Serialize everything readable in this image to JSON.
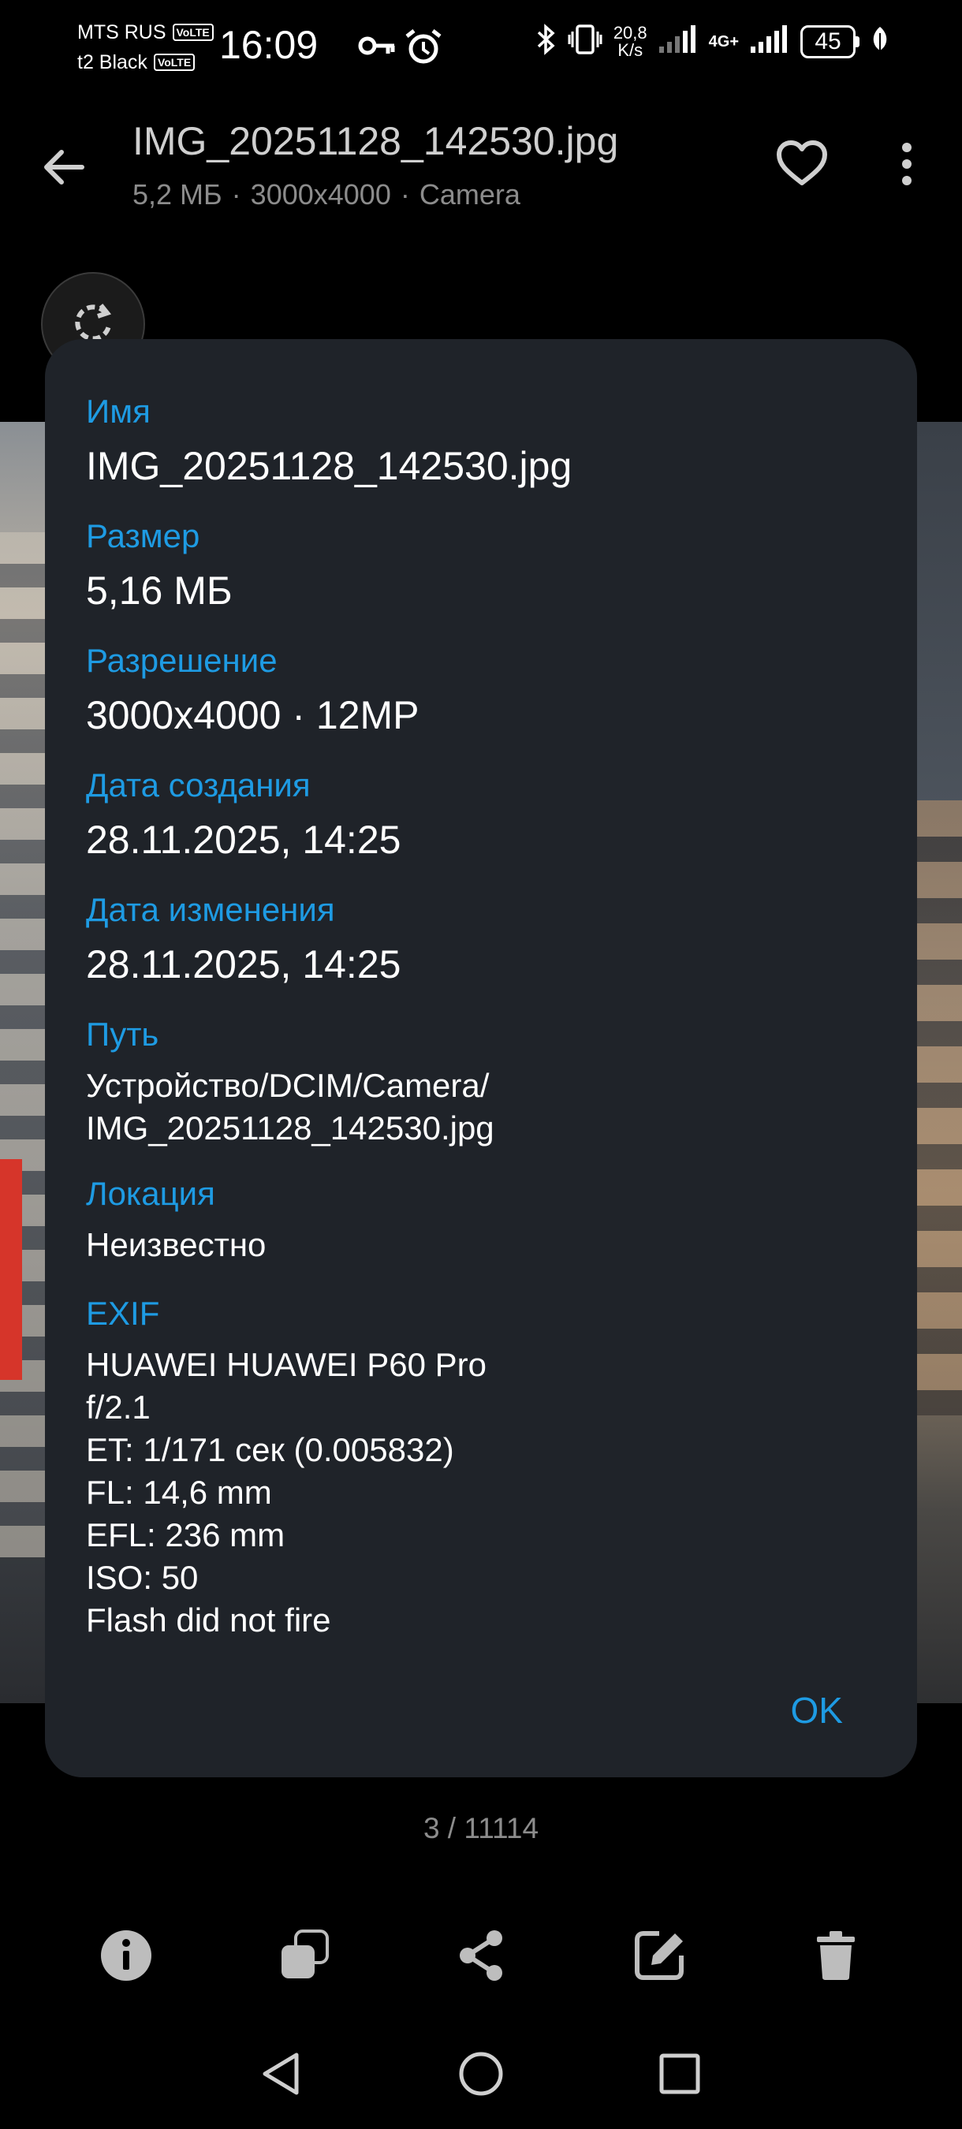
{
  "status_bar": {
    "carrier1": "MTS RUS",
    "carrier2": "t2 Black",
    "volte": "VoLTE",
    "time": "16:09",
    "speed_value": "20,8",
    "speed_unit": "K/s",
    "network": "4G+",
    "battery": "45",
    "icons": [
      "key-icon",
      "alarm-icon",
      "bluetooth-icon",
      "vibrate-icon",
      "signal-icon",
      "signal-icon",
      "battery-icon",
      "leaf-icon"
    ]
  },
  "header": {
    "title": "IMG_20251128_142530.jpg",
    "size": "5,2 МБ",
    "resolution": "3000x4000",
    "album": "Camera",
    "separator": "·"
  },
  "dialog": {
    "fields": [
      {
        "label": "Имя",
        "value": "IMG_20251128_142530.jpg"
      },
      {
        "label": "Размер",
        "value": "5,16 МБ"
      },
      {
        "label": "Разрешение",
        "value": "3000x4000 · 12MP"
      },
      {
        "label": "Дата создания",
        "value": "28.11.2025, 14:25"
      },
      {
        "label": "Дата изменения",
        "value": "28.11.2025, 14:25"
      },
      {
        "label": "Путь",
        "value_lines": [
          "Устройство/DCIM/Camera/",
          "IMG_20251128_142530.jpg"
        ]
      },
      {
        "label": "Локация",
        "value": "Неизвестно"
      },
      {
        "label": "EXIF",
        "value_lines": [
          "HUAWEI HUAWEI P60 Pro",
          "f/2.1",
          "ET: 1/171 сек (0.005832)",
          "FL: 14,6 mm",
          "EFL: 236 mm",
          "ISO: 50",
          "Flash did not fire"
        ]
      }
    ],
    "ok": "OK"
  },
  "counter": "3 / 11114",
  "colors": {
    "accent": "#1e9be3",
    "dialog_bg": "#1f2329",
    "background": "#000000",
    "secondary_text": "#8c8c8c"
  }
}
